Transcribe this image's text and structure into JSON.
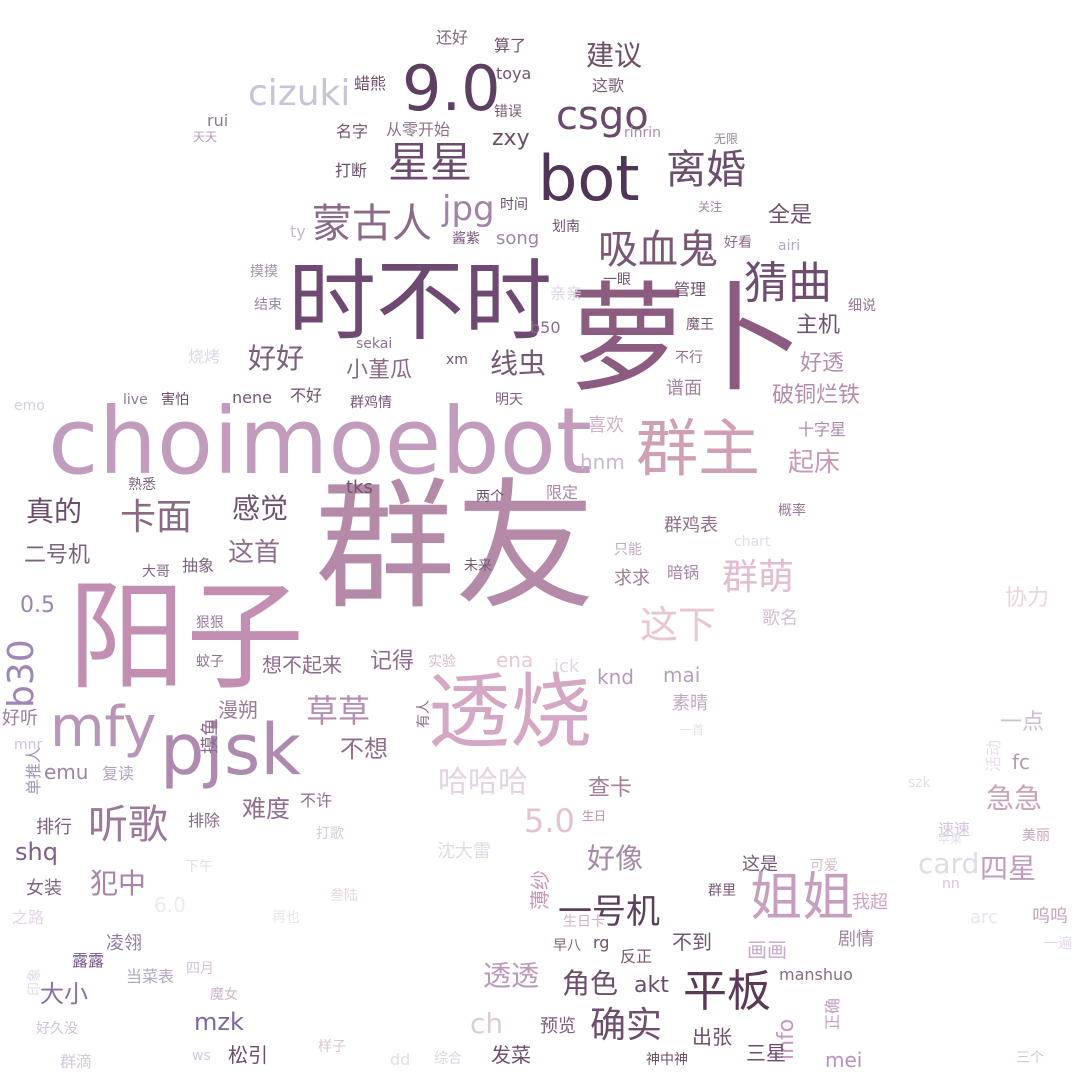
{
  "palette": {
    "background": "#ffffff",
    "deep_plum": "#5a3f5e",
    "mauve": "#8f6a8a",
    "rose": "#c49ab4",
    "pale_pink": "#e7cfd8",
    "faint": "#d8d4e4"
  },
  "words": [
    {
      "text": "群友",
      "color": "#b58aa8"
    },
    {
      "text": "萝卜",
      "color": "#8c5c80"
    },
    {
      "text": "阳子",
      "color": "#c28fb2"
    },
    {
      "text": "choimoebot",
      "color": "#c29cbc"
    },
    {
      "text": "时不时",
      "color": "#6e4a72"
    },
    {
      "text": "透烧",
      "color": "#d4a7c4"
    },
    {
      "text": "bot",
      "color": "#4f3656"
    },
    {
      "text": "9.0",
      "color": "#5d3f60"
    },
    {
      "text": "pjsk",
      "color": "#ad8aae"
    },
    {
      "text": "群主",
      "color": "#cf9fb6"
    },
    {
      "text": "mfy",
      "color": "#b996b8"
    },
    {
      "text": "姐姐",
      "color": "#c79fbe"
    },
    {
      "text": "平板",
      "color": "#5a3a55"
    },
    {
      "text": "猜曲",
      "color": "#6e4d70"
    },
    {
      "text": "星星",
      "color": "#6b4c6e"
    },
    {
      "text": "离婚",
      "color": "#6b4e6d"
    },
    {
      "text": "蒙古人",
      "color": "#8b6a87"
    },
    {
      "text": "吸血鬼",
      "color": "#7a5874"
    },
    {
      "text": "csgo",
      "color": "#6a4a6b"
    },
    {
      "text": "cizuki",
      "color": "#c8c3d6"
    },
    {
      "text": "jpg",
      "color": "#a283a7"
    },
    {
      "text": "卡面",
      "color": "#886a85"
    },
    {
      "text": "听歌",
      "color": "#9c7898"
    },
    {
      "text": "群萌",
      "color": "#e2bcd0"
    },
    {
      "text": "这下",
      "color": "#e8c7d4"
    },
    {
      "text": "确实",
      "color": "#6e4d6e"
    },
    {
      "text": "一号机",
      "color": "#5b405a"
    },
    {
      "text": "b30",
      "color": "#9f86b5"
    },
    {
      "text": "草草",
      "color": "#b58bb0"
    },
    {
      "text": "哈哈哈",
      "color": "#e3d4e4"
    },
    {
      "text": "5.0",
      "color": "#e3c2d4"
    },
    {
      "text": "好好",
      "color": "#7d5f7c"
    },
    {
      "text": "建议",
      "color": "#6b5068"
    },
    {
      "text": "感觉",
      "color": "#6e536e"
    },
    {
      "text": "真的",
      "color": "#6a4f6b"
    },
    {
      "text": "透透",
      "color": "#b99ab7"
    },
    {
      "text": "ch",
      "color": "#ddcbd8"
    },
    {
      "text": "线虫",
      "color": "#755a75"
    },
    {
      "text": "犯中",
      "color": "#a883a5"
    },
    {
      "text": "好像",
      "color": "#a48aa5"
    },
    {
      "text": "急急",
      "color": "#c8a2b8"
    },
    {
      "text": "四星",
      "color": "#c09dba"
    },
    {
      "text": "card",
      "color": "#e1dbe8"
    },
    {
      "text": "角色",
      "color": "#6d4f6c"
    },
    {
      "text": "akt",
      "color": "#6a4c6a"
    },
    {
      "text": "起床",
      "color": "#c99ab4"
    },
    {
      "text": "破铜烂铁",
      "color": "#b48bac"
    },
    {
      "text": "主机",
      "color": "#6e546f"
    },
    {
      "text": "好透",
      "color": "#b38fae"
    },
    {
      "text": "全是",
      "color": "#6f516f"
    },
    {
      "text": "zxy",
      "color": "#6b4f6a"
    },
    {
      "text": "小堇瓜",
      "color": "#8a6b86"
    },
    {
      "text": "这首",
      "color": "#8f6f8c"
    },
    {
      "text": "查卡",
      "color": "#a37f9b"
    },
    {
      "text": "info",
      "color": "#c59ac2"
    },
    {
      "text": "mzk",
      "color": "#7b68a3"
    },
    {
      "text": "大小",
      "color": "#8a6fa5"
    },
    {
      "text": "shq",
      "color": "#7d6188"
    },
    {
      "text": "二号机",
      "color": "#7d6382"
    },
    {
      "text": "0.5",
      "color": "#9d84ad"
    },
    {
      "text": "不想",
      "color": "#8f708c"
    },
    {
      "text": "难度",
      "color": "#8f6e8c"
    },
    {
      "text": "记得",
      "color": "#8c6c88"
    },
    {
      "text": "一点",
      "color": "#d1bfd1"
    },
    {
      "text": "协力",
      "color": "#e8d6de"
    },
    {
      "text": "hnm",
      "color": "#c9b8d4"
    },
    {
      "text": "fc",
      "color": "#b39cb7"
    },
    {
      "text": "emu",
      "color": "#9b84aa"
    },
    {
      "text": "薄纱",
      "color": "#c796be"
    },
    {
      "text": "画画",
      "color": "#c5aacb"
    },
    {
      "text": "不到",
      "color": "#735674"
    },
    {
      "text": "出张",
      "color": "#6d5069"
    },
    {
      "text": "三星",
      "color": "#6b4e6d"
    },
    {
      "text": "松引",
      "color": "#6c4e6a"
    },
    {
      "text": "发菜",
      "color": "#6f4f6c"
    },
    {
      "text": "预览",
      "color": "#7c5f7b"
    },
    {
      "text": "mei",
      "color": "#b692c2"
    },
    {
      "text": "ena",
      "color": "#e5c7d7"
    },
    {
      "text": "mai",
      "color": "#b7a0bd"
    },
    {
      "text": "knd",
      "color": "#b597c3"
    },
    {
      "text": "想不起来",
      "color": "#8e6c8c"
    },
    {
      "text": "漫朔",
      "color": "#9a7b98"
    },
    {
      "text": "song",
      "color": "#9c86a5"
    },
    {
      "text": "谱面",
      "color": "#a5819e"
    },
    {
      "text": "群鸡表",
      "color": "#8f6f8b"
    },
    {
      "text": "求求",
      "color": "#9b7f97"
    },
    {
      "text": "歌名",
      "color": "#d2c1d2"
    },
    {
      "text": "素晴",
      "color": "#c3a9c6"
    },
    {
      "text": "这是",
      "color": "#735a74"
    },
    {
      "text": "剧情",
      "color": "#a386a1"
    },
    {
      "text": "我超",
      "color": "#cfa3bf"
    },
    {
      "text": "呜呜",
      "color": "#c2a3bd"
    },
    {
      "text": "沈大雷",
      "color": "#e3d9e6"
    },
    {
      "text": "6.0",
      "color": "#efe9f0"
    },
    {
      "text": "女装",
      "color": "#7d667f"
    },
    {
      "text": "排行",
      "color": "#7d607f"
    },
    {
      "text": "好听",
      "color": "#9e7e9e"
    },
    {
      "text": "复读",
      "color": "#b4a2bf"
    },
    {
      "text": "凌翎",
      "color": "#8d7aa8"
    },
    {
      "text": "露露",
      "color": "#6f5487"
    },
    {
      "text": "当菜表",
      "color": "#b4a5c9"
    },
    {
      "text": "四月",
      "color": "#d1c5d8"
    },
    {
      "text": "魔女",
      "color": "#cdb7cc"
    },
    {
      "text": "manshuo",
      "color": "#876c84"
    },
    {
      "text": "正确",
      "color": "#c5a0c5"
    },
    {
      "text": "神中神",
      "color": "#6d5069"
    },
    {
      "text": "反正",
      "color": "#745675"
    },
    {
      "text": "早八",
      "color": "#7f627e"
    },
    {
      "text": "rg",
      "color": "#6c5269"
    },
    {
      "text": "生日卡",
      "color": "#cdb3c5"
    },
    {
      "text": "可爱",
      "color": "#d4b9cc"
    },
    {
      "text": "美丽",
      "color": "#c6a6bd"
    },
    {
      "text": "速速",
      "color": "#d5c4d9"
    },
    {
      "text": "nn",
      "color": "#d3c6d8"
    },
    {
      "text": "arc",
      "color": "#e8e3ee"
    },
    {
      "text": "一遍",
      "color": "#e2d7e6"
    },
    {
      "text": "三个",
      "color": "#d3c5d7"
    },
    {
      "text": "szk",
      "color": "#e1dde9"
    },
    {
      "text": "活动",
      "color": "#e9ddec"
    },
    {
      "text": "苹果",
      "color": "#e3dde9"
    },
    {
      "text": "群里",
      "color": "#7a5a78"
    },
    {
      "text": "下午",
      "color": "#e6dbe8"
    },
    {
      "text": "打歌",
      "color": "#d6cadc"
    },
    {
      "text": "不许",
      "color": "#8b6c89"
    },
    {
      "text": "排除",
      "color": "#866987"
    },
    {
      "text": "再也",
      "color": "#ebe6ee"
    },
    {
      "text": "叁陆",
      "color": "#e4d7e5"
    },
    {
      "text": "之路",
      "color": "#e3d5e5"
    },
    {
      "text": "印象",
      "color": "#e2dbe8"
    },
    {
      "text": "好久没",
      "color": "#d3c2dc"
    },
    {
      "text": "群滴",
      "color": "#d5c9de"
    },
    {
      "text": "ws",
      "color": "#d4c8e0"
    },
    {
      "text": "亲亲",
      "color": "#dfd3e4"
    },
    {
      "text": "样子",
      "color": "#d8c5d6"
    },
    {
      "text": "dd",
      "color": "#e5dce8"
    },
    {
      "text": "综合",
      "color": "#e0d2e4"
    },
    {
      "text": "单推人",
      "color": "#a494ba"
    },
    {
      "text": "mnr",
      "color": "#cdbfda"
    },
    {
      "text": "摸鱼",
      "color": "#8d6a8f"
    },
    {
      "text": "有人",
      "color": "#8c6d8a"
    },
    {
      "text": "实验",
      "color": "#d4b9ce"
    },
    {
      "text": "ick",
      "color": "#e1d5e5"
    },
    {
      "text": "一首",
      "color": "#e6dfe9"
    },
    {
      "text": "生日",
      "color": "#ba8eb5"
    },
    {
      "text": "狠狠",
      "color": "#9a7aa0"
    },
    {
      "text": "蚊子",
      "color": "#8f718f"
    },
    {
      "text": "大哥",
      "color": "#7f637f"
    },
    {
      "text": "抽象",
      "color": "#7d617d"
    },
    {
      "text": "未来",
      "color": "#755a75"
    },
    {
      "text": "只能",
      "color": "#c4aac6"
    },
    {
      "text": "暗锅",
      "color": "#a586a8"
    },
    {
      "text": "两个",
      "color": "#6d516c"
    },
    {
      "text": "限定",
      "color": "#ab86a7"
    },
    {
      "text": "熟悉",
      "color": "#806580"
    },
    {
      "text": "tks",
      "color": "#715471"
    },
    {
      "text": "概率",
      "color": "#987b98"
    },
    {
      "text": "chart",
      "color": "#e3dbe8"
    },
    {
      "text": "十字星",
      "color": "#ab8aab"
    },
    {
      "text": "喜欢",
      "color": "#cdb0c4"
    },
    {
      "text": "明天",
      "color": "#7f627e"
    },
    {
      "text": "群鸡情",
      "color": "#735574"
    },
    {
      "text": "不好",
      "color": "#6b4f6b"
    },
    {
      "text": "nene",
      "color": "#735774"
    },
    {
      "text": "害怕",
      "color": "#6c506b"
    },
    {
      "text": "live",
      "color": "#8d7895"
    },
    {
      "text": "emo",
      "color": "#d8ccdf"
    },
    {
      "text": "烧烤",
      "color": "#e0d7e6"
    },
    {
      "text": "结束",
      "color": "#9b869f"
    },
    {
      "text": "摸摸",
      "color": "#a193a9"
    },
    {
      "text": "ty",
      "color": "#c3b9cd"
    },
    {
      "text": "天天",
      "color": "#b39cb6"
    },
    {
      "text": "rui",
      "color": "#8e7b8f"
    },
    {
      "text": "蜡熊",
      "color": "#6c5069"
    },
    {
      "text": "从零开始",
      "color": "#8d728b"
    },
    {
      "text": "名字",
      "color": "#725672"
    },
    {
      "text": "打断",
      "color": "#6a4f6a"
    },
    {
      "text": "错误",
      "color": "#735872"
    },
    {
      "text": "toya",
      "color": "#715470"
    },
    {
      "text": "还好",
      "color": "#826780"
    },
    {
      "text": "算了",
      "color": "#6e526d"
    },
    {
      "text": "这歌",
      "color": "#7a5e79"
    },
    {
      "text": "rinrin",
      "color": "#a78ab2"
    },
    {
      "text": "无限",
      "color": "#9b849d"
    },
    {
      "text": "时间",
      "color": "#6b4f6b"
    },
    {
      "text": "划南",
      "color": "#6f536f"
    },
    {
      "text": "关注",
      "color": "#a0839f"
    },
    {
      "text": "好看",
      "color": "#8a6e89"
    },
    {
      "text": "airi",
      "color": "#b4a7c3"
    },
    {
      "text": "酱紫",
      "color": "#725674"
    },
    {
      "text": "一眼",
      "color": "#6f546e"
    },
    {
      "text": "管理",
      "color": "#6e526d"
    },
    {
      "text": "细说",
      "color": "#917790"
    },
    {
      "text": "b50",
      "color": "#8a6c89"
    },
    {
      "text": "sekai",
      "color": "#8c728b"
    },
    {
      "text": "xm",
      "color": "#6f546f"
    },
    {
      "text": "魔王",
      "color": "#765a76"
    },
    {
      "text": "不行",
      "color": "#8f708f"
    }
  ]
}
